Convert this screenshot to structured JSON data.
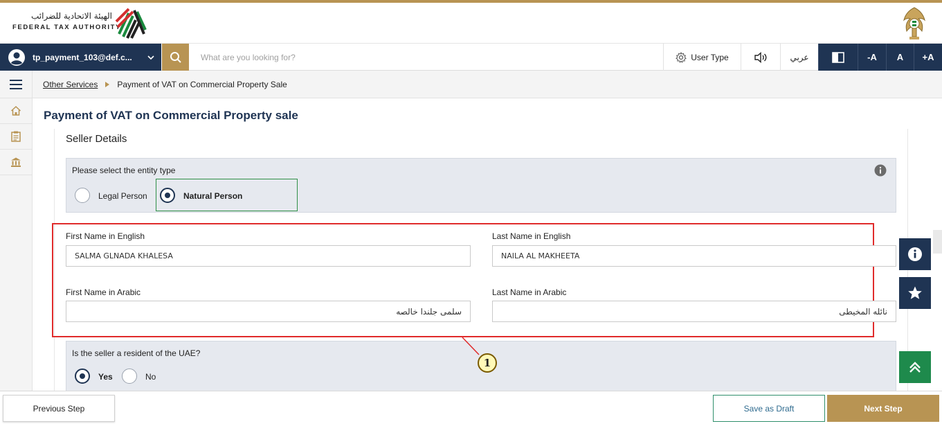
{
  "brand": {
    "name_ar": "الهيئة الاتحادية للضرائب",
    "name_en": "FEDERAL TAX AUTHORITY",
    "logo_icon": "fta-logo-icon",
    "emblem_icon": "uae-emblem-icon",
    "accent_color": "#b89453",
    "navy_color": "#1f3453"
  },
  "toolbar": {
    "user_email": "tp_payment_103@def.c...",
    "search_placeholder": "What are you looking for?",
    "user_type_label": "User Type",
    "language_label": "عربي",
    "font_decrease": "-A",
    "font_normal": "A",
    "font_increase": "+A"
  },
  "breadcrumb": {
    "parent": "Other Services",
    "current": "Payment of VAT on Commercial Property Sale"
  },
  "page": {
    "title": "Payment of VAT on Commercial Property sale",
    "section_title": "Seller Details"
  },
  "entity_type": {
    "label": "Please select the entity type",
    "options": [
      "Legal Person",
      "Natural Person"
    ],
    "selected": "Natural Person"
  },
  "fields": {
    "first_name_en": {
      "label": "First Name in English",
      "value": "SALMA GLNADA KHALESA"
    },
    "last_name_en": {
      "label": "Last Name in English",
      "value": "NAILA AL MAKHEETA"
    },
    "first_name_ar": {
      "label": "First Name in Arabic",
      "value": "سلمى جلندا خالصه"
    },
    "last_name_ar": {
      "label": "Last Name in Arabic",
      "value": "نائله المخيطى"
    }
  },
  "resident": {
    "question": "Is the seller a resident of the UAE?",
    "options": [
      "Yes",
      "No"
    ],
    "selected": "Yes"
  },
  "callout": {
    "number": "1",
    "color": "#e02b2b"
  },
  "footer": {
    "previous_label": "Previous Step",
    "draft_label": "Save as Draft",
    "next_label": "Next Step"
  }
}
